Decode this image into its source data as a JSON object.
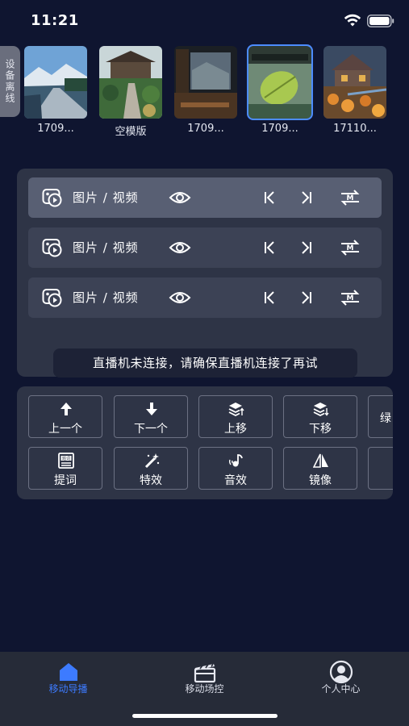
{
  "status": {
    "time": "11:21"
  },
  "device_tag": "设备离线",
  "thumbnails": [
    {
      "label": "1709...",
      "selected": false
    },
    {
      "label": "空模版",
      "selected": false
    },
    {
      "label": "1709...",
      "selected": false
    },
    {
      "label": "1709...",
      "selected": true
    },
    {
      "label": "17110...",
      "selected": false
    }
  ],
  "playlist": {
    "rows": [
      {
        "label": "图片 / 视频",
        "active": true
      },
      {
        "label": "图片 / 视频",
        "active": false
      },
      {
        "label": "图片 / 视频",
        "active": false
      }
    ]
  },
  "toast": "直播机未连接，请确保直播机连接了再试",
  "tools": {
    "row1": [
      {
        "label": "上一个",
        "icon": "arrow-up-icon"
      },
      {
        "label": "下一个",
        "icon": "arrow-down-icon"
      },
      {
        "label": "上移",
        "icon": "layer-up-icon"
      },
      {
        "label": "下移",
        "icon": "layer-down-icon"
      },
      {
        "label": "绿",
        "icon": ""
      }
    ],
    "row2": [
      {
        "label": "提词",
        "icon": "prompter-icon"
      },
      {
        "label": "特效",
        "icon": "magic-wand-icon"
      },
      {
        "label": "音效",
        "icon": "music-note-icon"
      },
      {
        "label": "镜像",
        "icon": "mirror-icon"
      },
      {
        "label": "",
        "icon": ""
      }
    ]
  },
  "nav": {
    "items": [
      {
        "label": "移动导播",
        "icon": "home-icon",
        "active": true
      },
      {
        "label": "移动场控",
        "icon": "clapperboard-icon",
        "active": false
      },
      {
        "label": "个人中心",
        "icon": "user-icon",
        "active": false
      }
    ]
  },
  "colors": {
    "accent": "#3d7bff",
    "background": "#0f1530",
    "panel": "#2e3446"
  }
}
